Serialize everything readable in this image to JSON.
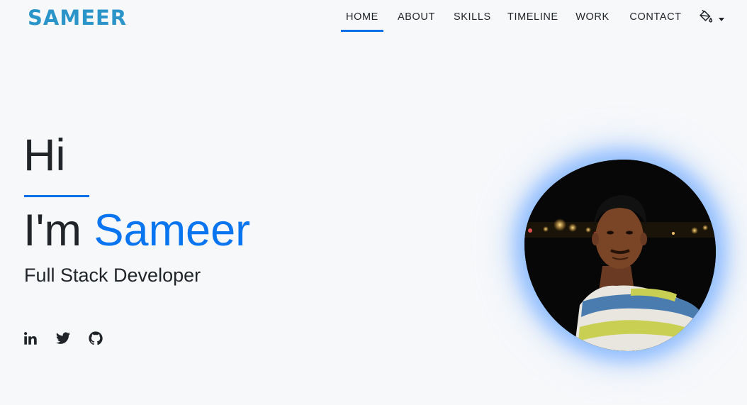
{
  "header": {
    "logo": "SAMEER",
    "nav": [
      {
        "label": "HOME",
        "active": true
      },
      {
        "label": "ABOUT",
        "active": false
      },
      {
        "label": "SKILLS",
        "active": false
      },
      {
        "label": "TIMELINE",
        "active": false
      },
      {
        "label": "WORK",
        "active": false
      },
      {
        "label": "CONTACT",
        "active": false
      }
    ],
    "theme_toggle_icon": "paint-bucket-icon"
  },
  "hero": {
    "greeting": "Hi",
    "intro_prefix": "I'm ",
    "name": "Sameer",
    "role": "Full Stack Developer",
    "socials": [
      "linkedin-icon",
      "twitter-icon",
      "github-icon"
    ]
  },
  "colors": {
    "accent": "#0a75f0",
    "logo": "#2b95c9",
    "background": "#f7f8fa",
    "text": "#212529",
    "photo_glow": "#78afff"
  }
}
